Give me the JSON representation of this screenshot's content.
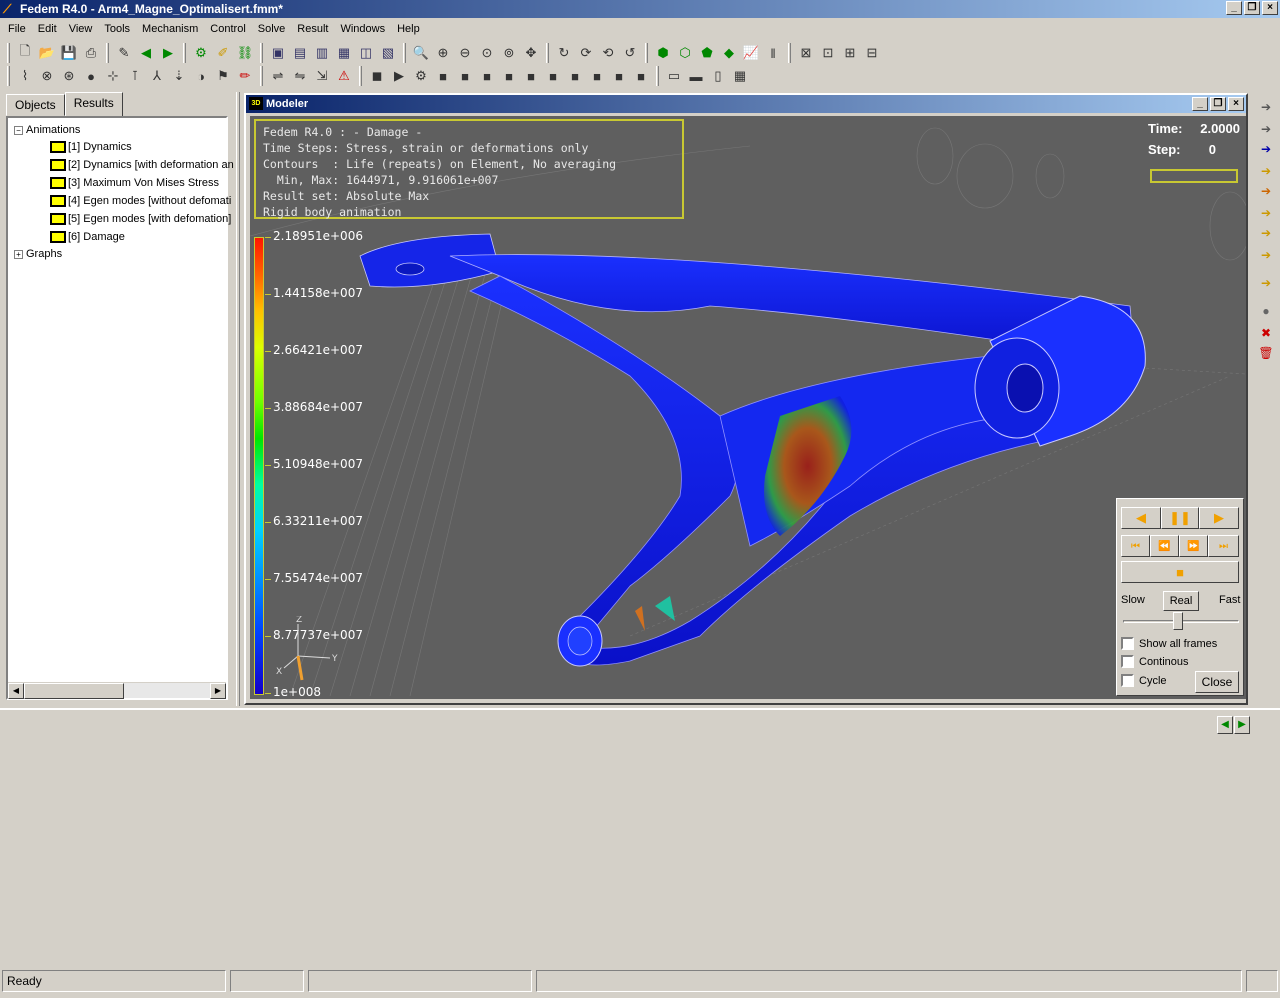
{
  "window": {
    "title": "Fedem R4.0 - Arm4_Magne_Optimalisert.fmm*",
    "minimize": "_",
    "restore": "❐",
    "close": "×"
  },
  "menubar": [
    "File",
    "Edit",
    "View",
    "Tools",
    "Mechanism",
    "Control",
    "Solve",
    "Result",
    "Windows",
    "Help"
  ],
  "tabs": {
    "objects": "Objects",
    "results": "Results"
  },
  "tree": {
    "animations": "Animations",
    "items": [
      "[1] Dynamics",
      "[2] Dynamics [with deformation an",
      "[3] Maximum Von Mises Stress",
      "[4] Egen modes [without defomati",
      "[5] Egen modes [with defomation]",
      "[6] Damage"
    ],
    "graphs": "Graphs"
  },
  "modeler": {
    "title": "Modeler",
    "info_lines": [
      "Fedem R4.0 : - Damage -",
      "Time Steps: Stress, strain or deformations only",
      "Contours  : Life (repeats) on Element, No averaging",
      "  Min, Max: 1644971, 9.916061e+007",
      "Result set: Absolute Max",
      "Rigid body animation"
    ],
    "time_label": "Time:",
    "time_value": "2.0000",
    "step_label": "Step:",
    "step_value": "0",
    "legend_labels": [
      "2.18951e+006",
      "1.44158e+007",
      "2.66421e+007",
      "3.88684e+007",
      "5.10948e+007",
      "6.33211e+007",
      "7.55474e+007",
      "8.77737e+007",
      "1e+008"
    ],
    "axes": {
      "x": "X",
      "y": "Y",
      "z": "Z"
    }
  },
  "animation_panel": {
    "slow": "Slow",
    "real": "Real",
    "fast": "Fast",
    "show_all_frames": "Show all frames",
    "continous": "Continous",
    "cycle": "Cycle",
    "close": "Close"
  },
  "statusbar": {
    "text": "Ready"
  }
}
